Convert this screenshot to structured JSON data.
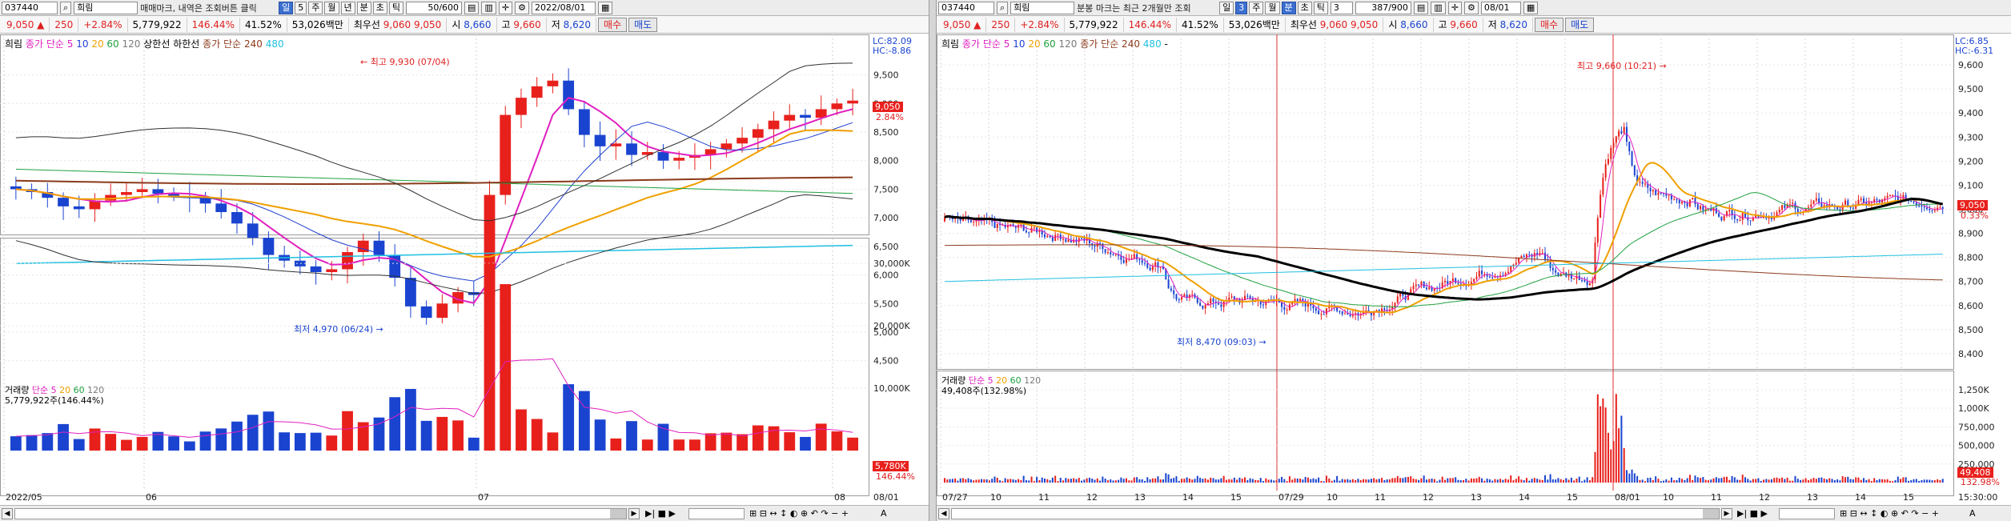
{
  "left": {
    "toolbar": {
      "code": "037440",
      "name": "희림",
      "hint": "매매마크, 내역은 조회버튼 클릭",
      "periods": [
        {
          "label": "일",
          "active": true
        },
        {
          "label": "5",
          "active": false
        },
        {
          "label": "주",
          "active": false
        },
        {
          "label": "월",
          "active": false
        },
        {
          "label": "년",
          "active": false
        },
        {
          "label": "분",
          "active": false
        },
        {
          "label": "초",
          "active": false
        },
        {
          "label": "틱",
          "active": false
        }
      ],
      "count": "50/600",
      "date": "2022/08/01"
    },
    "quote": {
      "price": "9,050",
      "change": "250",
      "rate": "+2.84%",
      "volume": "5,779,922",
      "volume_ratio": "146.44%",
      "turnover": "41.52%",
      "amount": "53,026백만",
      "pref_label": "최우선",
      "ask": "9,060",
      "bid": "9,050",
      "open_label": "시",
      "open": "8,660",
      "high_label": "고",
      "high": "9,660",
      "low_label": "저",
      "low": "8,620",
      "buy_label": "매수",
      "sell_label": "매도"
    },
    "legend": {
      "stock": "희림",
      "ma_label": "종가 단순",
      "ma_periods": [
        "5",
        "10",
        "20",
        "60",
        "120"
      ],
      "band_upper": "상한선",
      "band_lower": "하한선",
      "ma2_label": "종가 단순 240",
      "ma2_period": "480"
    },
    "lc": "LC:82.09",
    "hc": "HC:-8.86",
    "high_note": "최고 9,930 (07/04)",
    "low_note": "최저 4,970 (06/24)",
    "price_tag": "9,050",
    "price_tag_pct": "2.84%",
    "y_ticks": [
      "9,500",
      "9,000",
      "8,500",
      "8,000",
      "7,500",
      "7,000",
      "6,500",
      "6,000",
      "5,500",
      "5,000",
      "4,500"
    ],
    "vol_legend": {
      "label": "거래량",
      "ma_label": "단순 5",
      "periods": [
        "20",
        "60",
        "120"
      ],
      "value": "5,779,922주(146.44%)"
    },
    "vol_ticks": [
      "30,000K",
      "20,000K",
      "10,000K"
    ],
    "vol_tag": "5,780K",
    "vol_tag_pct": "146.44%",
    "x_ticks": [
      "2022/05",
      "06",
      "07",
      "08"
    ],
    "x_right": "08/01",
    "colors": {
      "up": "#e8201c",
      "down": "#1a44d0",
      "ma5": "#e020c0",
      "ma10": "#2040d0",
      "ma20": "#f0a000",
      "ma60": "#20a040",
      "ma120": "#7a7a7a",
      "ma240": "#8b3a1a",
      "ma480": "#20c0e0",
      "band": "#303030"
    }
  },
  "right": {
    "toolbar": {
      "code": "037440",
      "name": "희림",
      "hint": "분봉 마크는 최근 2개월만 조회",
      "periods": [
        {
          "label": "일",
          "active": false
        },
        {
          "label": "3",
          "active": true
        },
        {
          "label": "주",
          "active": false
        },
        {
          "label": "월",
          "active": false
        },
        {
          "label": "분",
          "active": true
        },
        {
          "label": "초",
          "active": false
        },
        {
          "label": "틱",
          "active": false
        }
      ],
      "interval": "3",
      "count": "387/900",
      "date": "08/01"
    },
    "quote": {
      "price": "9,050",
      "change": "250",
      "rate": "+2.84%",
      "volume": "5,779,922",
      "volume_ratio": "146.44%",
      "turnover": "41.52%",
      "amount": "53,026백만",
      "pref_label": "최우선",
      "ask": "9,060",
      "bid": "9,050",
      "open_label": "시",
      "open": "8,660",
      "high_label": "고",
      "high": "9,660",
      "low_label": "저",
      "low": "8,620",
      "buy_label": "매수",
      "sell_label": "매도"
    },
    "legend": {
      "stock": "희림",
      "ma_label": "종가 단순",
      "ma_periods": [
        "5",
        "10",
        "20",
        "60",
        "120"
      ],
      "ma2_label": "종가 단순 240",
      "ma2_period": "480",
      "extra": "-"
    },
    "lc": "LC:6.85",
    "hc": "HC:-6.31",
    "high_note": "최고 9,660 (10:21)",
    "low_note": "최저 8,470 (09:03)",
    "price_tag": "9,050",
    "price_tag_pct": "0.33%",
    "y_ticks": [
      "9,600",
      "9,500",
      "9,400",
      "9,300",
      "9,200",
      "9,100",
      "9,000",
      "8,900",
      "8,800",
      "8,700",
      "8,600",
      "8,500",
      "8,400"
    ],
    "vol_legend": {
      "label": "거래량",
      "ma_label": "단순 5",
      "periods": [
        "20",
        "60",
        "120"
      ],
      "value": "49,408주(132.98%)"
    },
    "vol_ticks": [
      "1,250K",
      "1,000K",
      "750,000",
      "500,000",
      "250,000"
    ],
    "vol_tag": "49,408",
    "vol_tag_pct": "132.98%",
    "x_ticks": [
      "07/27",
      "10",
      "11",
      "12",
      "13",
      "14",
      "15",
      "07/29",
      "10",
      "11",
      "12",
      "13",
      "14",
      "15",
      "08/01",
      "10",
      "11",
      "12",
      "13",
      "14",
      "15"
    ],
    "x_right": "15:30:00"
  }
}
